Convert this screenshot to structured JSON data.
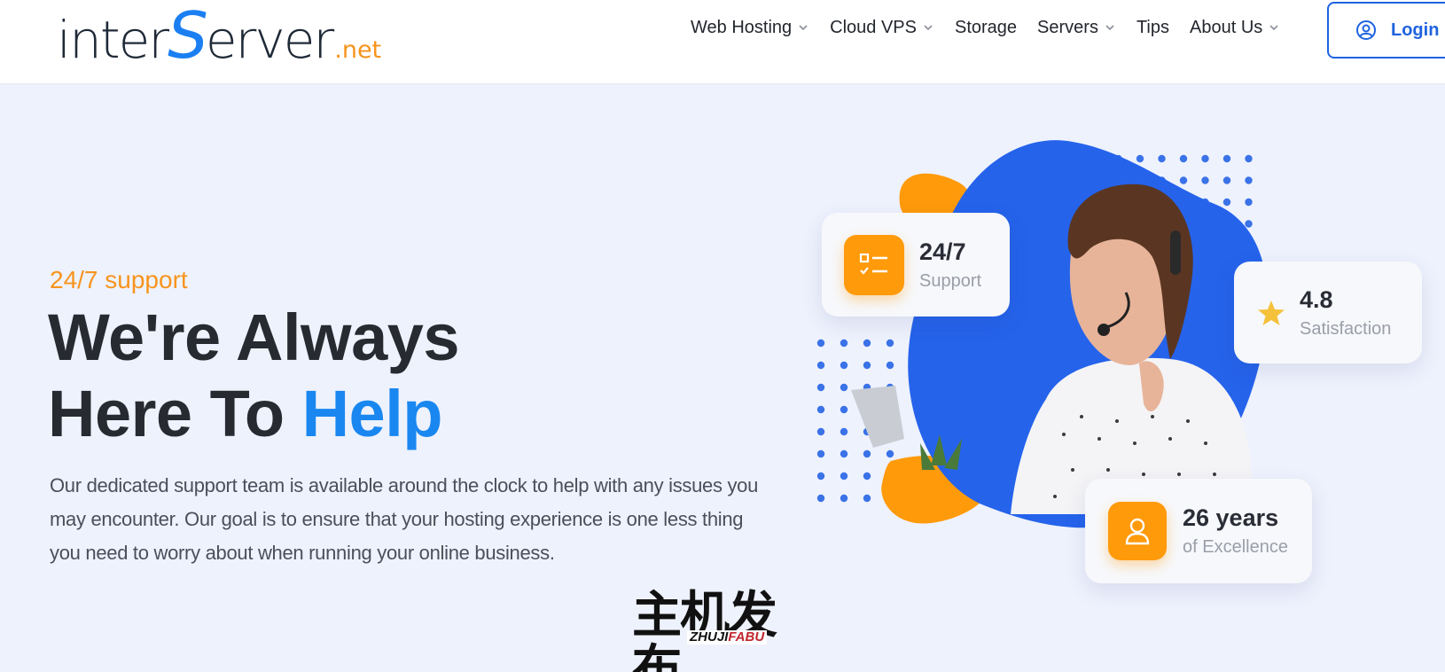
{
  "header": {
    "logo": {
      "part1": "inter",
      "part2": "S",
      "part3": "erver",
      "part4": ".net"
    },
    "nav": [
      {
        "label": "Web Hosting",
        "has_dropdown": true
      },
      {
        "label": "Cloud VPS",
        "has_dropdown": true
      },
      {
        "label": "Storage",
        "has_dropdown": false
      },
      {
        "label": "Servers",
        "has_dropdown": true
      },
      {
        "label": "Tips",
        "has_dropdown": false
      },
      {
        "label": "About Us",
        "has_dropdown": true
      }
    ],
    "login_label": "Login"
  },
  "hero": {
    "eyebrow": "24/7 support",
    "headline_line1": "We're Always",
    "headline_line2_prefix": "Here To ",
    "headline_line2_accent": "Help",
    "paragraph": "Our dedicated support team is available around the clock to help with any issues you may encounter. Our goal is to ensure that your hosting experience is one less thing you need to worry about when running your online business."
  },
  "stats": [
    {
      "value": "24/7",
      "label": "Support",
      "icon": "checklist-icon"
    },
    {
      "value": "4.8",
      "label": "Satisfaction",
      "icon": "star-icon"
    },
    {
      "value": "26 years",
      "label": "of Excellence",
      "icon": "user-icon"
    }
  ],
  "watermark": {
    "cn": "主机发布",
    "latin_a": "ZHUJI",
    "latin_b": "FABU"
  },
  "colors": {
    "accent_blue": "#1a87f0",
    "brand_blue": "#1e63e0",
    "orange": "#f7941d",
    "blob_blue": "#2563eb"
  }
}
